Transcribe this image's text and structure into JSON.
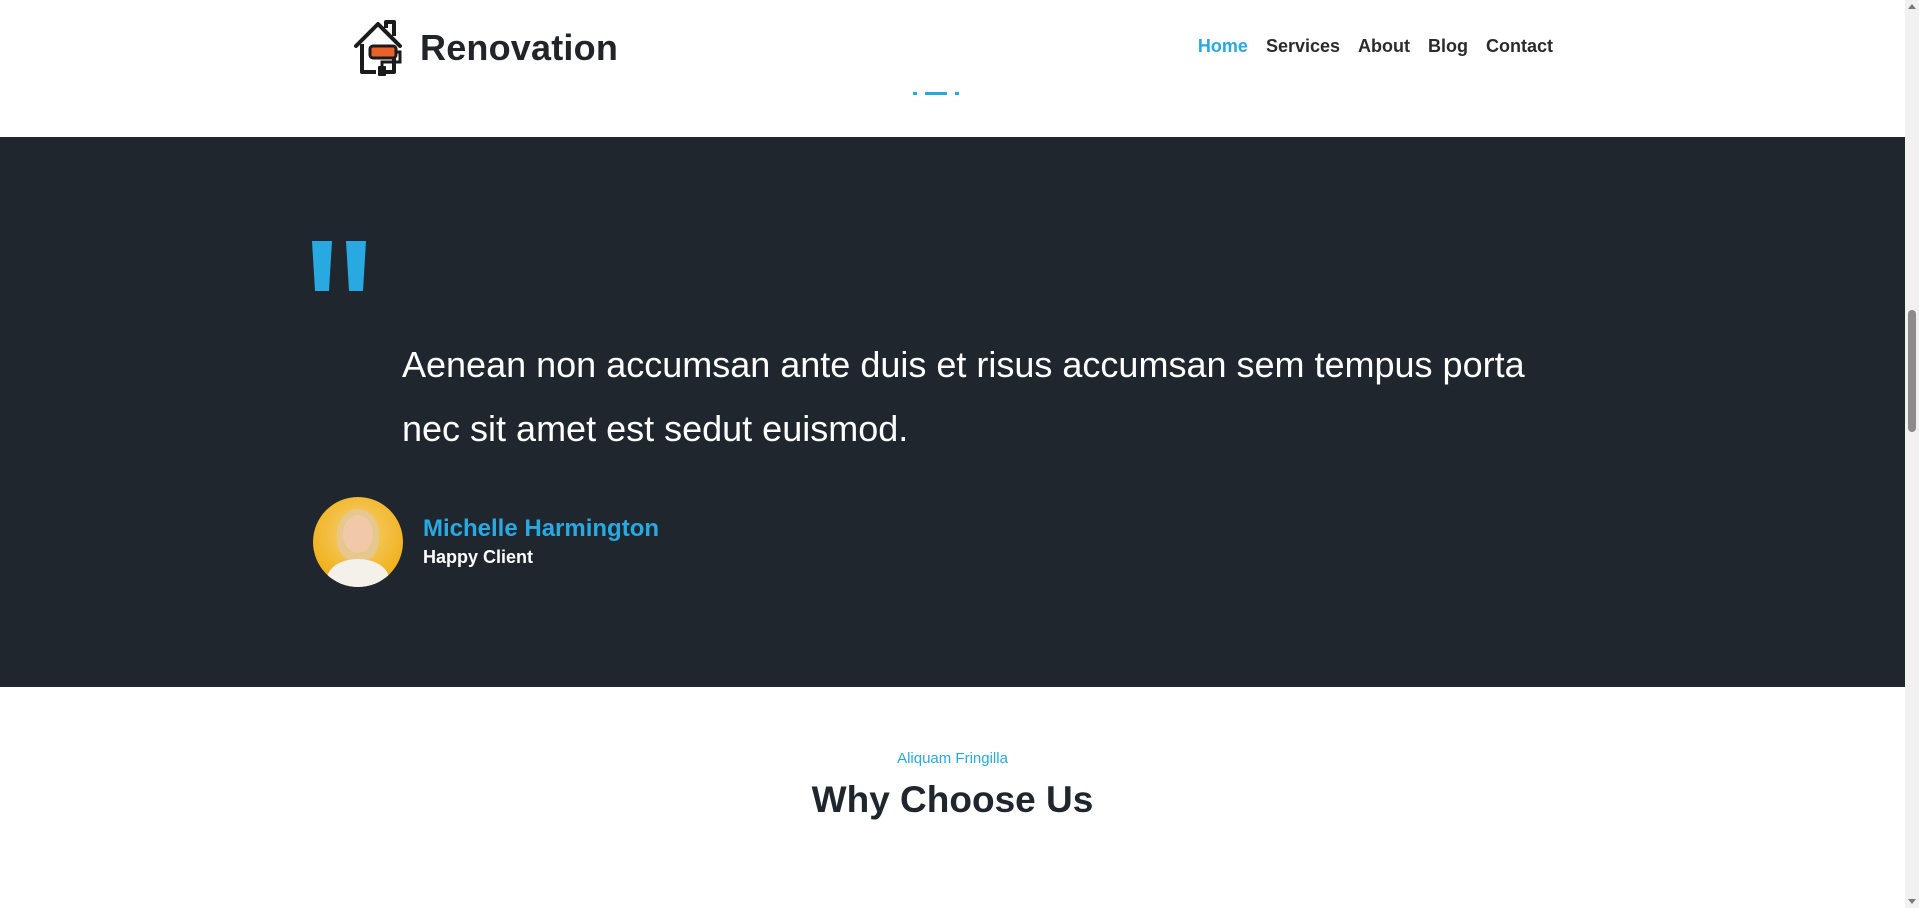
{
  "header": {
    "logo_text": "Renovation",
    "nav": [
      {
        "label": "Home",
        "active": true
      },
      {
        "label": "Services",
        "active": false
      },
      {
        "label": "About",
        "active": false
      },
      {
        "label": "Blog",
        "active": false
      },
      {
        "label": "Contact",
        "active": false
      }
    ]
  },
  "testimonial": {
    "quote_icon": "quote-icon",
    "text": "Aenean non accumsan ante duis et risus accumsan sem tempus porta nec sit amet est sedut euismod.",
    "author_name": "Michelle Harmington",
    "author_role": "Happy Client"
  },
  "why": {
    "eyebrow": "Aliquam Fringilla",
    "title": "Why Choose Us"
  },
  "colors": {
    "accent": "#29a9e1",
    "dark": "#20262e",
    "text_dark": "#212529"
  }
}
